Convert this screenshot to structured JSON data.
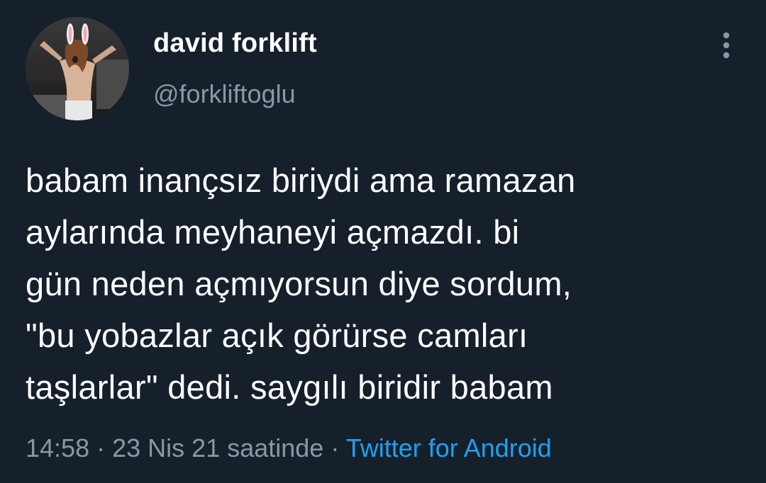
{
  "author": {
    "display_name": "david forklift",
    "handle": "@forkliftoglu",
    "avatar_icon": "profile-photo-avatar"
  },
  "tweet": {
    "text_lines": [
      "babam inançsız biriydi ama ramazan",
      "aylarında meyhaneyi açmazdı. bi",
      "gün neden açmıyorsun diye sordum,",
      "\"bu yobazlar açık görürse camları",
      "taşlarlar\" dedi. saygılı biridir babam"
    ],
    "time": "14:58",
    "separator": "·",
    "date": "23 Nis 21 saatinde",
    "source": "Twitter for Android"
  },
  "menu": {
    "icon": "more-vertical-icon"
  },
  "colors": {
    "background": "#15202b",
    "primary_text": "#ffffff",
    "secondary_text": "#8899a6",
    "link": "#1da1f2"
  }
}
